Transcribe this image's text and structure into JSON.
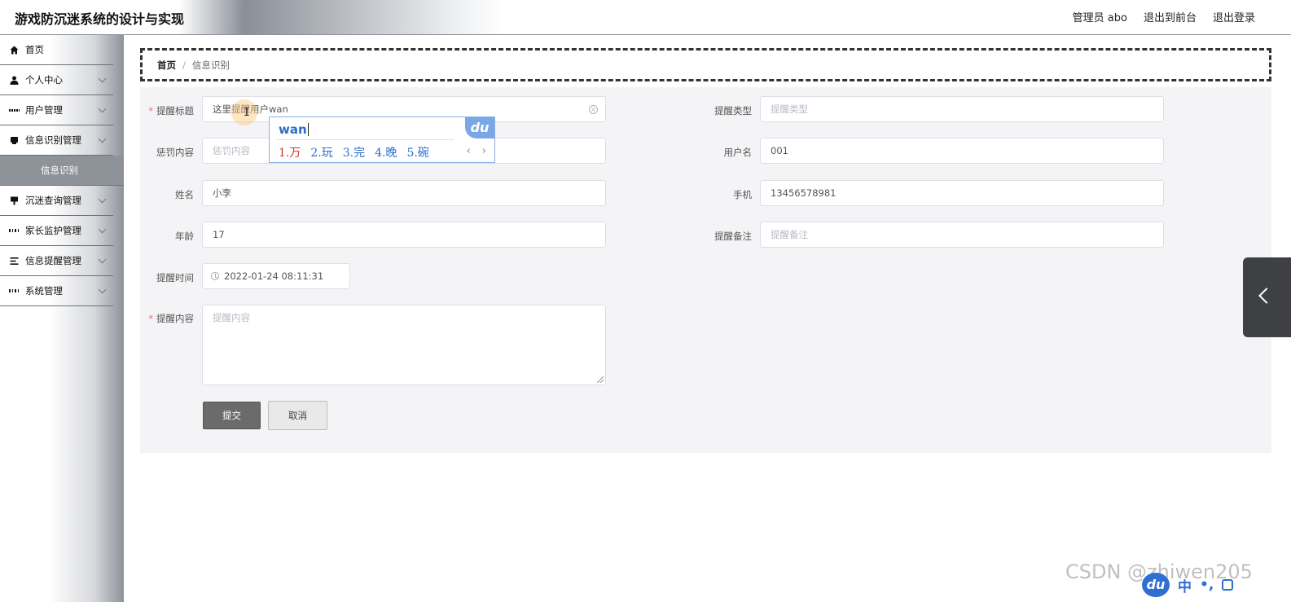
{
  "header": {
    "title": "游戏防沉迷系统的设计与实现",
    "nav": [
      "管理员 abo",
      "退出到前台",
      "退出登录"
    ]
  },
  "sidebar": {
    "items": [
      {
        "label": "首页",
        "icon": "home-icon",
        "has_children": false
      },
      {
        "label": "个人中心",
        "icon": "user-icon",
        "has_children": true
      },
      {
        "label": "用户管理",
        "icon": "grid-icon",
        "has_children": true
      },
      {
        "label": "信息识别管理",
        "icon": "tag-icon",
        "has_children": true
      },
      {
        "label": "沉迷查询管理",
        "icon": "pin-icon",
        "has_children": true
      },
      {
        "label": "家长监护管理",
        "icon": "apps-icon",
        "has_children": true
      },
      {
        "label": "信息提醒管理",
        "icon": "list-icon",
        "has_children": true
      },
      {
        "label": "系统管理",
        "icon": "apps-icon",
        "has_children": true
      }
    ],
    "active_sub": "信息识别"
  },
  "breadcrumb": {
    "home": "首页",
    "separator": "/",
    "current": "信息识别"
  },
  "form": {
    "title_label": "提醒标题",
    "title_value": "这里提醒用户wan",
    "type_label": "提醒类型",
    "type_placeholder": "提醒类型",
    "penalty_label": "惩罚内容",
    "penalty_placeholder": "惩罚内容",
    "username_label": "用户名",
    "username_value": "001",
    "name_label": "姓名",
    "name_value": "小李",
    "phone_label": "手机",
    "phone_value": "13456578981",
    "age_label": "年龄",
    "age_value": "17",
    "remark_label": "提醒备注",
    "remark_placeholder": "提醒备注",
    "time_label": "提醒时间",
    "time_value": "2022-01-24 08:11:31",
    "content_label": "提醒内容",
    "content_placeholder": "提醒内容",
    "required_mark": "*",
    "submit": "提交",
    "cancel": "取消"
  },
  "ime": {
    "pinyin": "wan",
    "logo": "du",
    "candidates": [
      "1.万",
      "2.玩",
      "3.完",
      "4.晚",
      "5.碗"
    ],
    "prev": "‹",
    "next": "›"
  },
  "watermark": "CSDN @zhiwen205",
  "tray": {
    "logo": "du",
    "lang": "中",
    "dot": "•,"
  }
}
